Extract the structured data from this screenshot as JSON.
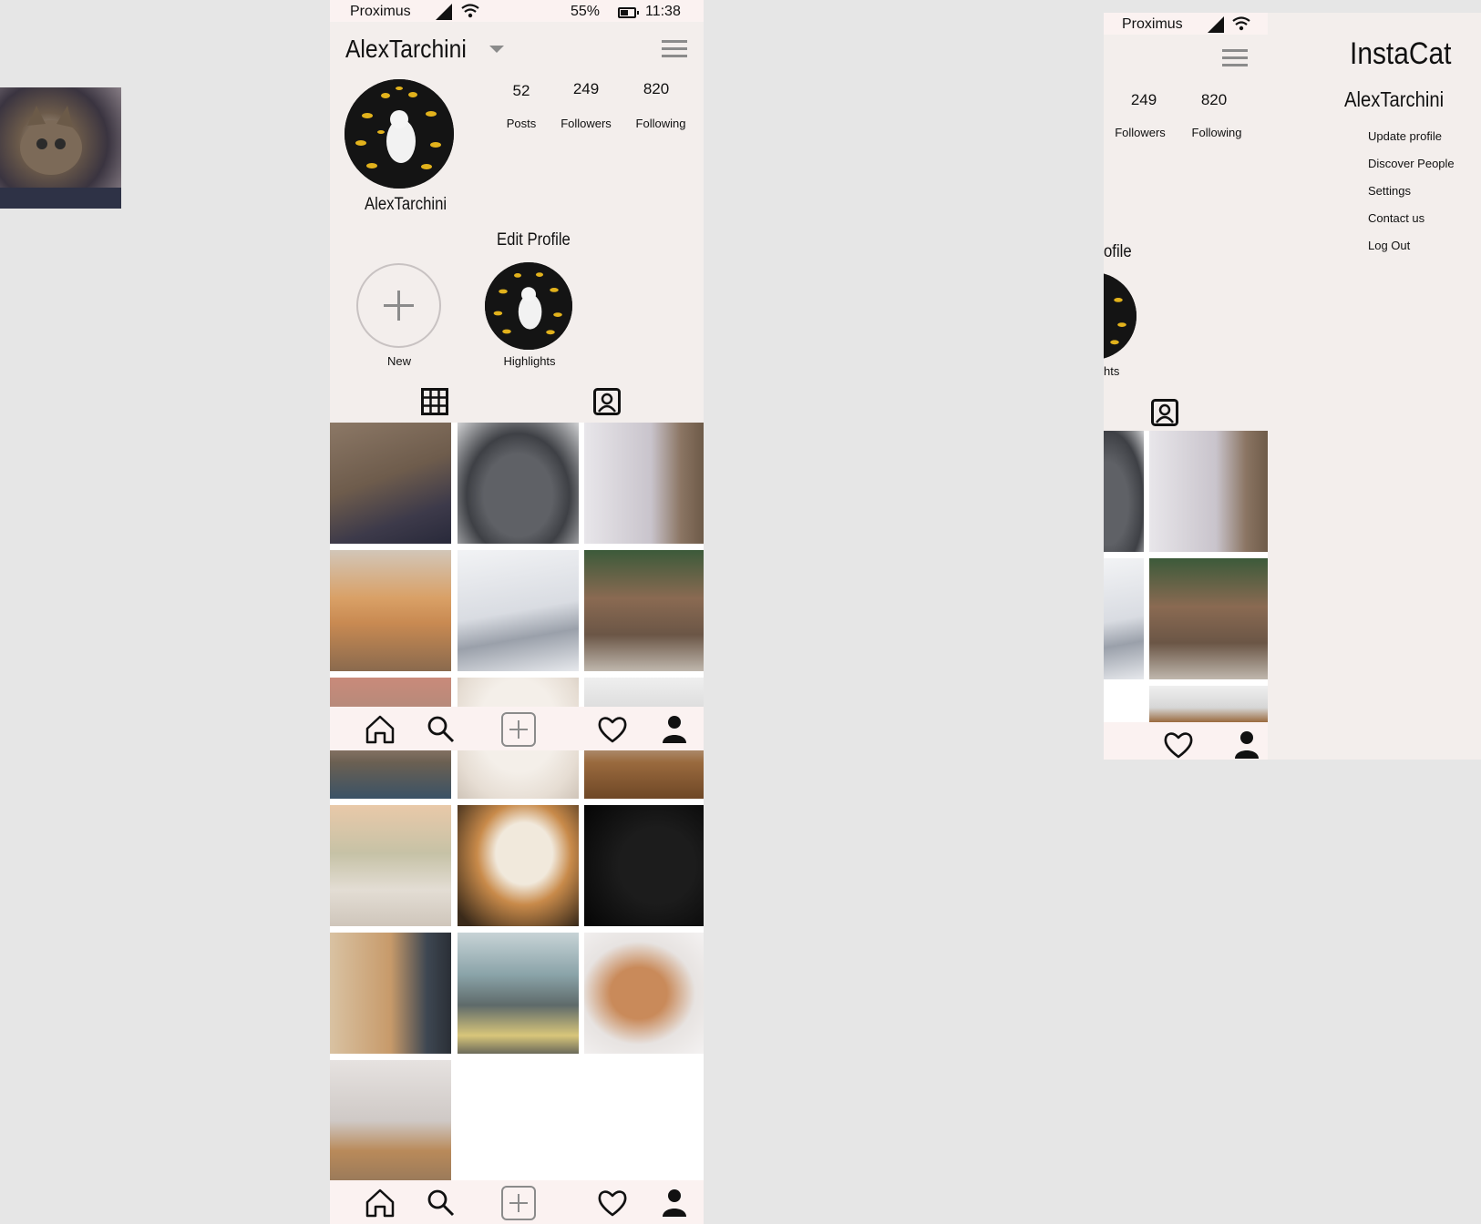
{
  "status_bar": {
    "carrier": "Proximus",
    "battery": "55%",
    "time": "11:38"
  },
  "profile": {
    "username": "AlexTarchini",
    "display_name": "AlexTarchini",
    "stats": {
      "posts": {
        "value": "52",
        "label": "Posts"
      },
      "followers": {
        "value": "249",
        "label": "Followers"
      },
      "following": {
        "value": "820",
        "label": "Following"
      }
    },
    "edit_profile_label": "Edit Profile",
    "highlights": [
      {
        "label": "New"
      },
      {
        "label": "Highlights"
      }
    ]
  },
  "tabs": [
    {
      "name": "grid-tab",
      "icon": "grid-icon"
    },
    {
      "name": "tagged-tab",
      "icon": "tagged-person-icon"
    }
  ],
  "bottom_nav": [
    {
      "name": "home",
      "icon": "home-icon"
    },
    {
      "name": "search",
      "icon": "search-icon"
    },
    {
      "name": "add",
      "icon": "add-post-icon"
    },
    {
      "name": "activity",
      "icon": "heart-icon"
    },
    {
      "name": "profile",
      "icon": "person-icon"
    }
  ],
  "drawer": {
    "app_title": "InstaCat",
    "username": "AlexTarchini",
    "items": [
      "Update profile",
      "Discover People",
      "Settings",
      "Contact us",
      "Log Out"
    ]
  },
  "phone2_peek": {
    "followers_value": "249",
    "followers_label": "Followers",
    "following_value": "820",
    "following_label": "Following",
    "edit_fragment": "ofile",
    "highlight_fragment": "hts"
  },
  "colors": {
    "page_bg": "#e6e6e6",
    "phone_bg": "#f3eeec",
    "nav_bg": "#fbf2f1",
    "icon_grey": "#8b8b8b"
  }
}
